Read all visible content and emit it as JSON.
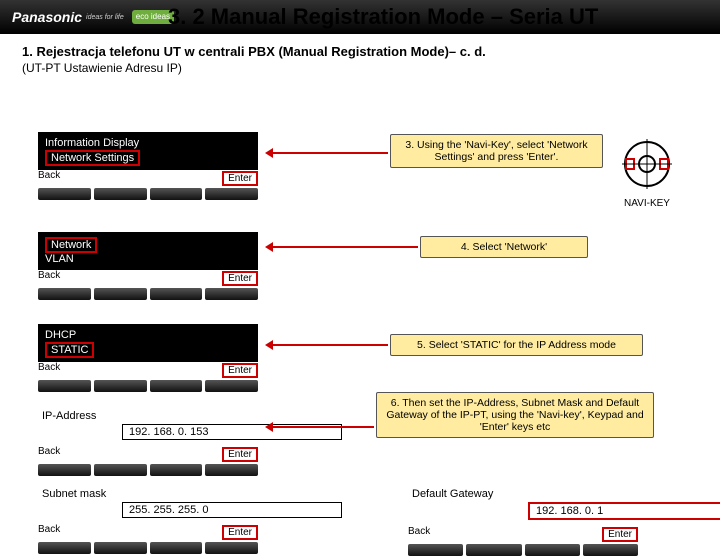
{
  "header": {
    "brand": "Panasonic",
    "tagline": "ideas for life",
    "eco": "eco ideas",
    "title": "3. 2 Manual Registration Mode – Seria UT"
  },
  "heading": "1. Rejestracja telefonu UT w centrali PBX (Manual Registration Mode)– c. d.",
  "sub": "(UT-PT Ustawienie Adresu IP)",
  "phones": {
    "p1": {
      "l1": "Information Display",
      "l2": "Network Settings",
      "back": "Back",
      "enter": "Enter"
    },
    "p2": {
      "l1": "Network",
      "l2": "VLAN",
      "back": "Back",
      "enter": "Enter"
    },
    "p3": {
      "l1": "DHCP",
      "l2": "STATIC",
      "back": "Back",
      "enter": "Enter"
    },
    "p4": {
      "l1": "IP-Address",
      "ip": "192. 168. 0. 153",
      "back": "Back",
      "enter": "Enter"
    },
    "p5": {
      "l1": "Subnet mask",
      "ip": "255. 255. 255. 0",
      "back": "Back",
      "enter": "Enter"
    },
    "p6": {
      "l1": "Default Gateway",
      "ip": "192. 168. 0. 1",
      "back": "Back",
      "enter": "Enter"
    }
  },
  "callouts": {
    "c3": "3. Using the 'Navi-Key', select 'Network Settings' and press 'Enter'.",
    "c4": "4. Select 'Network'",
    "c5": "5. Select 'STATIC' for the IP Address mode",
    "c6": "6. Then set the IP-Address, Subnet Mask and Default Gateway of the IP-PT, using the 'Navi-key', Keypad and 'Enter' keys etc"
  },
  "navi": "NAVI-KEY"
}
